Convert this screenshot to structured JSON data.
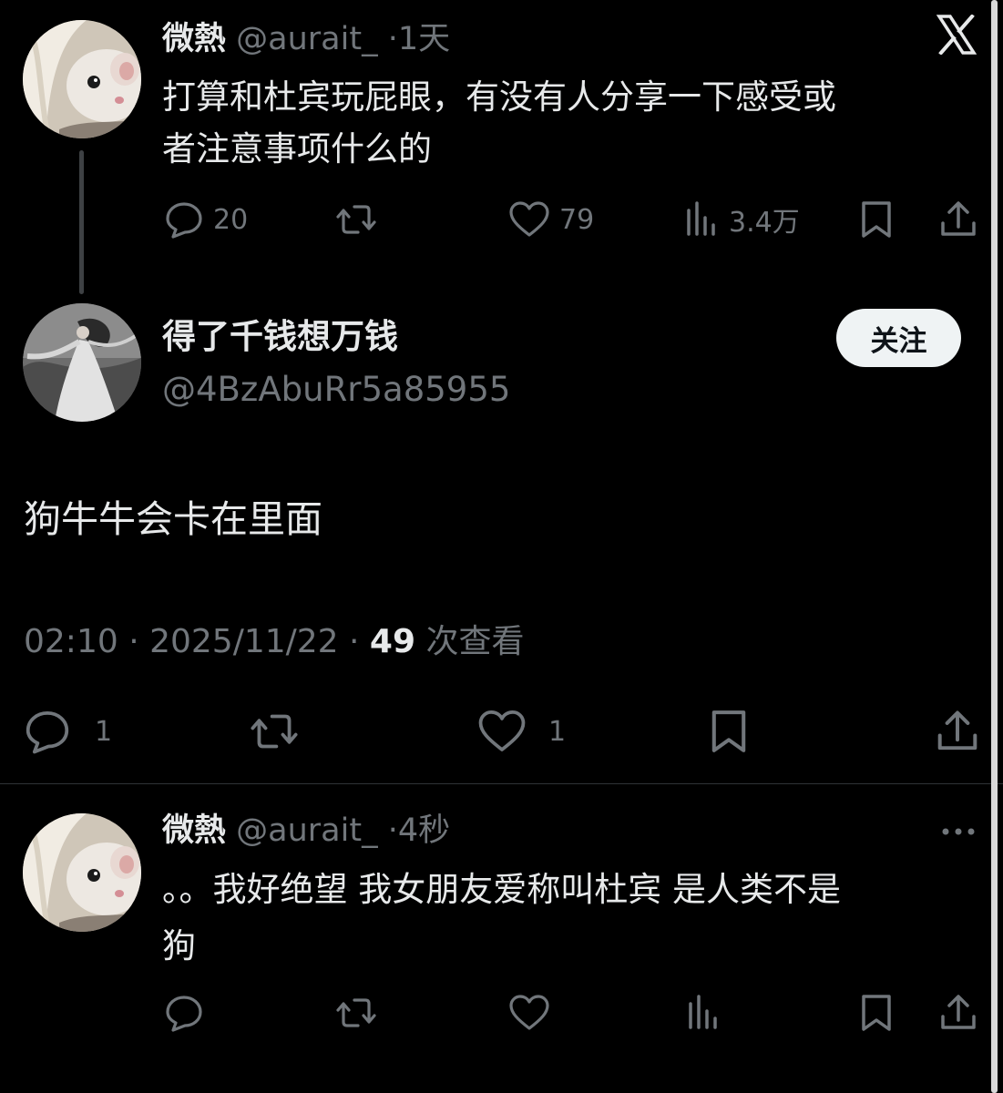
{
  "tweet1": {
    "name": "微熱",
    "handle": "@aurait_",
    "time": "1天",
    "text_lines": [
      "打算和杜宾玩屁眼，有没有人分享一下感受或",
      "者注意事项什么的"
    ],
    "replies": "20",
    "likes": "79",
    "views": "3.4万"
  },
  "reply": {
    "name": "得了千钱想万钱",
    "handle": "@4BzAbuRr5a85955",
    "follow_label": "关注",
    "text": "狗牛牛会卡在里面",
    "timestamp": "02:10 · 2025/11/22 · ",
    "view_count": "49",
    "view_label": " 次查看",
    "replies": "1",
    "likes": "1"
  },
  "tweet3": {
    "name": "微熱",
    "handle": "@aurait_",
    "time": "4秒",
    "text_lines": [
      "。。我好绝望 我女朋友爱称叫杜宾 是人类不是",
      "狗"
    ]
  },
  "icons": {
    "top_right": "x-logo-icon",
    "reply": "speech-bubble-icon",
    "retweet": "retweet-icon",
    "like": "heart-icon",
    "views": "bar-chart-icon",
    "bookmark": "bookmark-icon",
    "share": "share-upload-icon",
    "more": "more-dots-icon"
  },
  "colors": {
    "background": "#000000",
    "text": "#e7e9ea",
    "secondary": "#71767b",
    "divider": "#2f3336",
    "follow_button": "#eff3f4"
  },
  "separator": "·"
}
